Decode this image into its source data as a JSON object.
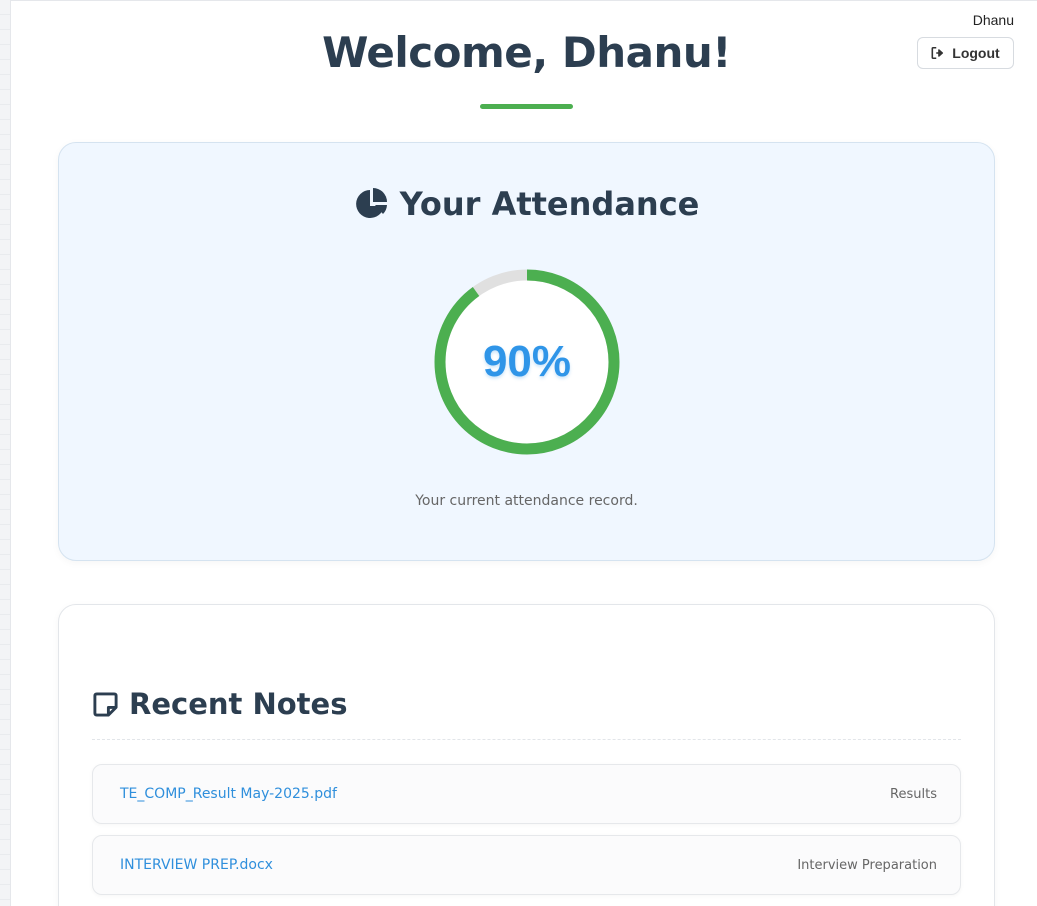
{
  "header": {
    "user_name": "Dhanu",
    "logout_label": "Logout",
    "welcome_title": "Welcome, Dhanu!"
  },
  "attendance": {
    "title": "Your Attendance",
    "percent": 90,
    "percent_label": "90%",
    "caption": "Your current attendance record.",
    "ring_color": "#4caf50",
    "track_color": "#e0e0e0"
  },
  "notes": {
    "title": "Recent Notes",
    "items": [
      {
        "name": "TE_COMP_Result May-2025.pdf",
        "category": "Results"
      },
      {
        "name": "INTERVIEW PREP.docx",
        "category": "Interview Preparation"
      }
    ]
  },
  "colors": {
    "accent_green": "#4caf50",
    "link_blue": "#2f8fdc",
    "heading": "#2c3e50"
  },
  "icons": {
    "attendance": "chart-pie-icon",
    "notes": "sticky-note-icon",
    "logout": "sign-out-icon"
  }
}
